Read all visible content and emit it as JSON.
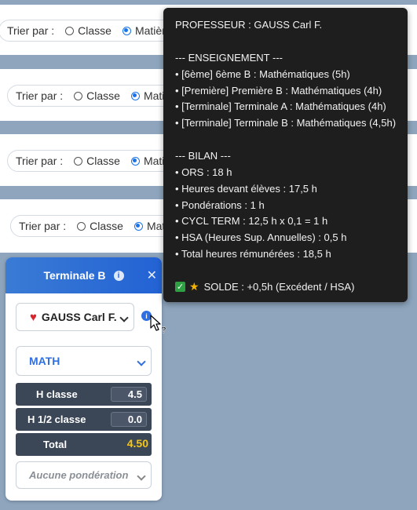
{
  "sort_bars": [
    {
      "label": "Trier par :",
      "opt1": "Classe",
      "opt2": "Matière"
    },
    {
      "label": "Trier par :",
      "opt1": "Classe",
      "opt2": "Matière"
    },
    {
      "label": "Trier par :",
      "opt1": "Classe",
      "opt2": "Matière"
    },
    {
      "label": "Trier par :",
      "opt1": "Classe",
      "opt2": "Matière"
    }
  ],
  "card": {
    "title": "Terminale B",
    "teacher": "GAUSS Carl F.",
    "subject": "MATH",
    "h_classe_label": "H classe",
    "h_classe_value": "4.5",
    "h_half_label": "H 1/2 classe",
    "h_half_value": "0.0",
    "total_label": "Total",
    "total_value": "4.50",
    "ponderation": "Aucune pondération",
    "colors": {
      "header": "#2262d4",
      "total": "#f5c518",
      "row": "#3b4656"
    }
  },
  "tooltip": {
    "title": "PROFESSEUR : GAUSS Carl F.",
    "section_ens": "--- ENSEIGNEMENT ---",
    "ens": [
      "• [6ème] 6ème B : Mathématiques (5h)",
      "• [Première] Première B : Mathématiques (4h)",
      "• [Terminale] Terminale A : Mathématiques (4h)",
      "• [Terminale] Terminale B : Mathématiques (4,5h)"
    ],
    "section_bilan": "--- BILAN ---",
    "bilan": [
      "• ORS : 18 h",
      "• Heures devant élèves : 17,5 h",
      "• Pondérations : 1 h",
      "• CYCL TERM : 12,5 h x 0,1 = 1 h",
      "• HSA (Heures Sup. Annuelles) : 0,5 h",
      "• Total heures rémunérées : 18,5 h"
    ],
    "solde": "SOLDE : +0,5h (Excédent / HSA)"
  },
  "icons": [
    "heart-icon",
    "info-icon",
    "close-icon",
    "check-icon",
    "star-icon",
    "help-cursor-icon",
    "chevron-down-icon"
  ]
}
